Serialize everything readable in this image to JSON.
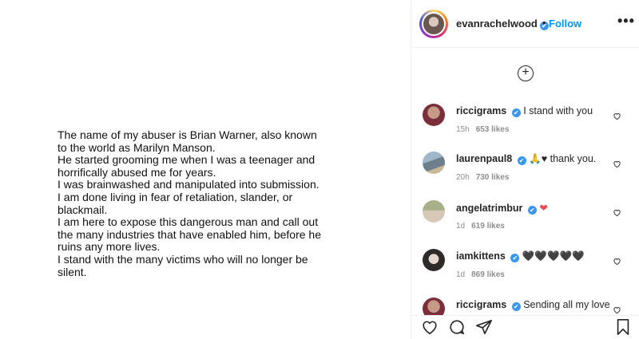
{
  "post": {
    "lines": [
      "The name of my abuser is Brian Warner, also known",
      "to the world as Marilyn Manson.",
      "He started grooming me when I was a teenager and",
      "horrifically abused me for years.",
      "I was brainwashed and manipulated into submission.",
      "I am done living in fear of retaliation, slander, or",
      "blackmail.",
      "I am here to expose this dangerous man and call out",
      "the many industries that have enabled him, before he",
      "ruins any more lives.",
      "I stand with the many victims who will no longer be",
      "silent."
    ]
  },
  "header": {
    "username": "evanrachelwood",
    "separator": "•",
    "follow_label": "Follow",
    "more_label": "•••"
  },
  "load_more_label": "+",
  "comments": [
    {
      "user": "riccigrams",
      "text": "I stand with you",
      "time": "15h",
      "likes": "653 likes"
    },
    {
      "user": "laurenpaul8",
      "text": "🙏♥ thank you.",
      "time": "20h",
      "likes": "730 likes"
    },
    {
      "user": "angelatrimbur",
      "text": "❤",
      "time": "1d",
      "likes": "619 likes"
    },
    {
      "user": "iamkittens",
      "text": "🖤🖤🖤🖤🖤",
      "time": "1d",
      "likes": "869 likes"
    },
    {
      "user": "riccigrams",
      "text": "Sending all my love",
      "time": "",
      "likes": ""
    }
  ],
  "icons": {
    "verified": "✔",
    "like": "heart-icon",
    "comment": "comment-icon",
    "share": "share-icon",
    "save": "bookmark-icon"
  },
  "colors": {
    "accent": "#0095f6",
    "verified": "#3897f0",
    "heart_red": "#ed4956"
  }
}
